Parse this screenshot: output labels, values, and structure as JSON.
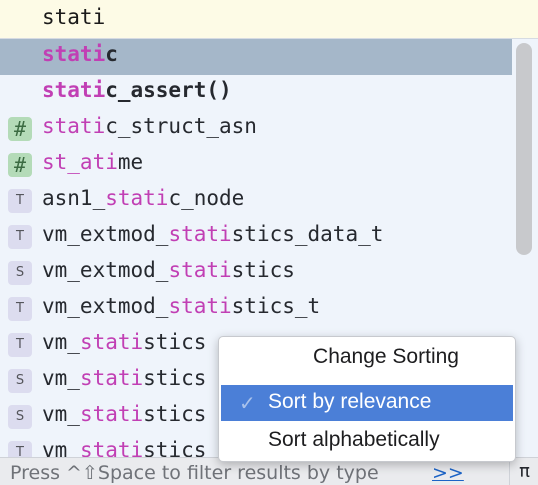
{
  "editor": {
    "typed_text": "stati"
  },
  "completion": {
    "items": [
      {
        "icon": "",
        "pre": "",
        "match": "stati",
        "post": "c",
        "bold": true,
        "selected": true
      },
      {
        "icon": "",
        "pre": "",
        "match": "stati",
        "post": "c_assert()",
        "bold": true,
        "selected": false
      },
      {
        "icon": "#",
        "pre": "",
        "match": "stati",
        "post": "c_struct_asn",
        "bold": false,
        "selected": false
      },
      {
        "icon": "#",
        "pre": "",
        "match": "st_ati",
        "post": "me",
        "bold": false,
        "selected": false
      },
      {
        "icon": "T",
        "pre": "asn1_",
        "match": "stati",
        "post": "c_node",
        "bold": false,
        "selected": false
      },
      {
        "icon": "T",
        "pre": "vm_extmod_",
        "match": "stati",
        "post": "stics_data_t",
        "bold": false,
        "selected": false
      },
      {
        "icon": "S",
        "pre": "vm_extmod_",
        "match": "stati",
        "post": "stics",
        "bold": false,
        "selected": false
      },
      {
        "icon": "T",
        "pre": "vm_extmod_",
        "match": "stati",
        "post": "stics_t",
        "bold": false,
        "selected": false
      },
      {
        "icon": "T",
        "pre": "vm_",
        "match": "stati",
        "post": "stics",
        "bold": false,
        "selected": false
      },
      {
        "icon": "S",
        "pre": "vm_",
        "match": "stati",
        "post": "stics",
        "bold": false,
        "selected": false
      },
      {
        "icon": "S",
        "pre": "vm_",
        "match": "stati",
        "post": "stics",
        "bold": false,
        "selected": false
      },
      {
        "icon": "T",
        "pre": "vm_",
        "match": "stati",
        "post": "stics",
        "bold": false,
        "selected": false
      }
    ],
    "footer_text": "Press ^⇧Space to filter results by type",
    "footer_link": ">>",
    "pi_button": "π"
  },
  "sort_menu": {
    "title": "Change Sorting",
    "options": [
      {
        "label": "Sort by relevance",
        "checked": true,
        "check_mark": "✓"
      },
      {
        "label": "Sort alphabetically",
        "checked": false,
        "check_mark": ""
      }
    ]
  },
  "colors": {
    "match": "#c13fb4",
    "selection": "#a5b7c9",
    "menu_active": "#4b7fd7"
  }
}
